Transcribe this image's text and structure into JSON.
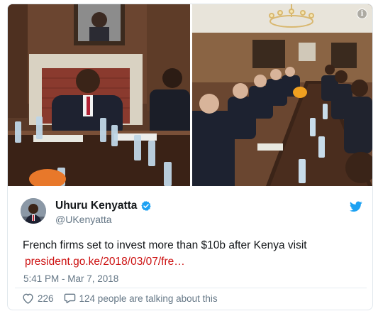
{
  "tweet": {
    "display_name": "Uhuru Kenyatta",
    "handle": "@UKenyatta",
    "text": "French firms set to invest more than $10b after Kenya visit",
    "link": "president.go.ke/2018/03/07/fre…",
    "timestamp": "5:41 PM - Mar 7, 2018",
    "likes": "226",
    "conversation": "124 people are talking about this"
  },
  "media": {
    "info_glyph": "i"
  },
  "icons": [
    "info-icon",
    "verified-badge-icon",
    "twitter-bird-icon",
    "heart-icon",
    "reply-bubble-icon"
  ],
  "colors": {
    "link": "#cc1010",
    "verified": "#1da1f2",
    "twitter_brand": "#1da1f2",
    "secondary_text": "#657786",
    "primary_text": "#14171a"
  }
}
